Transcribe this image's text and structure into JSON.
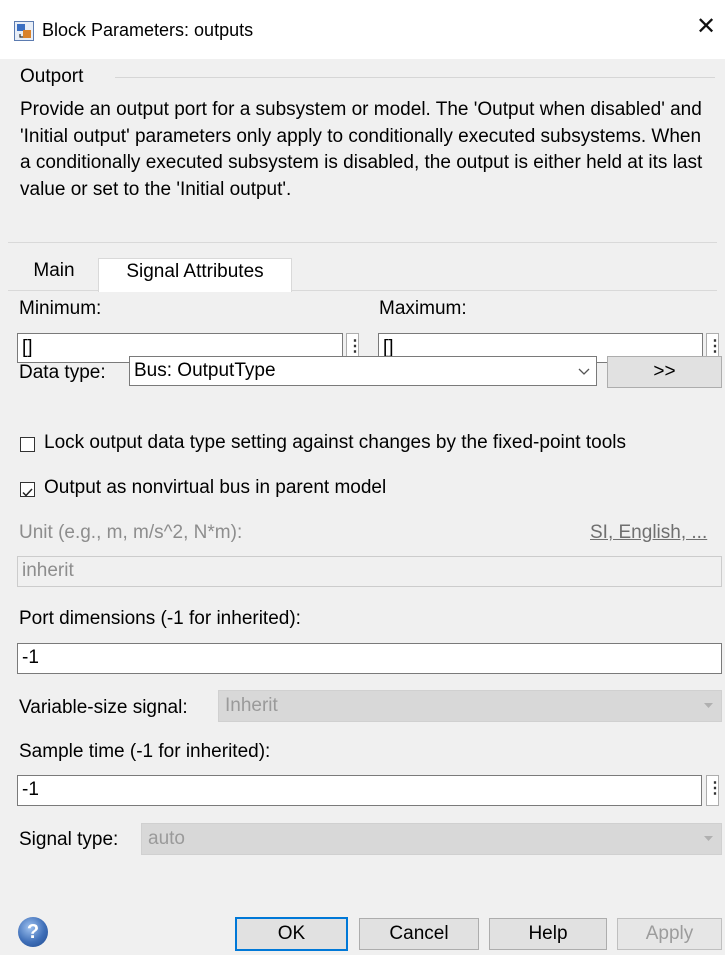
{
  "window": {
    "title": "Block Parameters: outputs",
    "close_glyph": "✕"
  },
  "group": {
    "title": "Outport",
    "description": "Provide an output port for a subsystem or model.  The 'Output when disabled' and 'Initial output' parameters only apply to conditionally executed subsystems. When a conditionally executed subsystem is disabled, the output is either held at its last value or set to the 'Initial output'."
  },
  "tabs": [
    {
      "label": "Main",
      "active": false
    },
    {
      "label": "Signal Attributes",
      "active": true
    }
  ],
  "fields": {
    "minimum_label": "Minimum:",
    "minimum_value": "[]",
    "maximum_label": "Maximum:",
    "maximum_value": "[]",
    "data_type_label": "Data type:",
    "data_type_value": "Bus: OutputType",
    "data_type_button": ">>",
    "lock_label": "Lock output data type setting against changes by the fixed-point tools",
    "lock_checked": false,
    "nonvirtual_label": "Output as nonvirtual bus in parent model",
    "nonvirtual_checked": true,
    "unit_label": "Unit (e.g., m, m/s^2, N*m):",
    "unit_link": "SI, English, ...",
    "unit_value": "inherit",
    "port_dims_label": "Port dimensions (-1 for inherited):",
    "port_dims_value": "-1",
    "variable_size_label": "Variable-size signal:",
    "variable_size_value": "Inherit",
    "sample_time_label": "Sample time (-1 for inherited):",
    "sample_time_value": "-1",
    "signal_type_label": "Signal type:",
    "signal_type_value": "auto"
  },
  "footer": {
    "help_icon_glyph": "?",
    "ok": "OK",
    "cancel": "Cancel",
    "help": "Help",
    "apply": "Apply"
  },
  "icons": {
    "app": "block-parameters-icon",
    "close": "close-icon",
    "help": "help-icon",
    "kebab": "kebab-menu-icon",
    "dropdown": "chevron-down-icon",
    "check": "checkmark-icon"
  },
  "colors": {
    "primary_button_border": "#0078d7",
    "dialog_background": "#f0f0f0"
  }
}
